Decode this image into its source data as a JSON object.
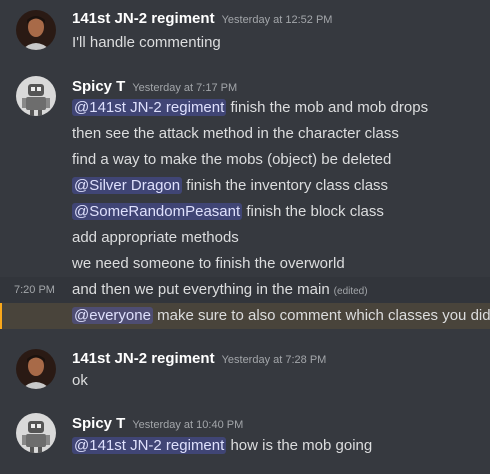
{
  "colors": {
    "background": "#36393f",
    "username": "#ffffff",
    "text": "#dcddde",
    "timestamp": "#a3a6aa",
    "mention_bg": "#4f5591",
    "highlight_bar": "#faa81a"
  },
  "messages": [
    {
      "author": "141st JN-2 regiment",
      "timestamp": "Yesterday at 12:52 PM",
      "avatar_icon": "portrait-avatar-icon",
      "lines": [
        {
          "text": "I'll handle commenting"
        }
      ]
    },
    {
      "author": "Spicy T",
      "timestamp": "Yesterday at 7:17 PM",
      "avatar_icon": "robot-avatar-icon",
      "lines": [
        {
          "mention": "@141st JN-2 regiment",
          "text": " finish the mob and mob drops"
        },
        {
          "text": "then see the attack method in the character class"
        },
        {
          "text": "find a way to make the mobs (object) be deleted"
        },
        {
          "mention": "@Silver Dragon",
          "text": " finish the inventory class class"
        },
        {
          "mention": "@SomeRandomPeasant",
          "text": " finish the block class"
        },
        {
          "text": "add appropriate methods"
        },
        {
          "text": "we need someone to finish the overworld"
        },
        {
          "text": "and then we put everything in the main",
          "edited": "(edited)",
          "side_timestamp": "7:20 PM"
        },
        {
          "mention": "@everyone",
          "text": " make sure to also comment which classes you did"
        }
      ]
    },
    {
      "author": "141st JN-2 regiment",
      "timestamp": "Yesterday at 7:28 PM",
      "avatar_icon": "portrait-avatar-icon",
      "lines": [
        {
          "text": "ok"
        }
      ]
    },
    {
      "author": "Spicy T",
      "timestamp": "Yesterday at 10:40 PM",
      "avatar_icon": "robot-avatar-icon",
      "lines": [
        {
          "mention": "@141st JN-2 regiment",
          "text": " how is the mob going"
        }
      ]
    }
  ]
}
